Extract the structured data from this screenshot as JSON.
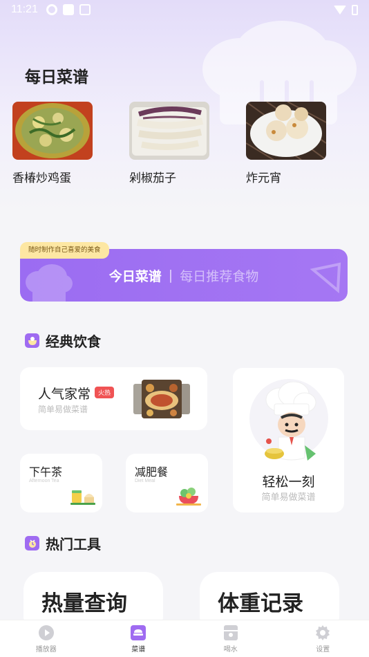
{
  "status_bar": {
    "time": "11:21"
  },
  "daily": {
    "title": "每日菜谱",
    "items": [
      {
        "name": "香椿炒鸡蛋"
      },
      {
        "name": "剁椒茄子"
      },
      {
        "name": "炸元宵"
      }
    ]
  },
  "banner": {
    "tag": "随时制作自己喜爱的美食",
    "main": "今日菜谱",
    "separator": "|",
    "sub": "每日推荐食物"
  },
  "classic": {
    "title": "经典饮食",
    "popular": {
      "title": "人气家常",
      "badge": "火热",
      "subtitle": "简单易做菜谱"
    },
    "easy": {
      "title": "轻松一刻",
      "subtitle": "简单易做菜谱"
    },
    "tea": {
      "title": "下午茶",
      "subtitle": "Afternoon Tea"
    },
    "diet": {
      "title": "减肥餐",
      "subtitle": "Diet Meal"
    }
  },
  "tools": {
    "title": "热门工具",
    "items": [
      {
        "label": "热量查询"
      },
      {
        "label": "体重记录"
      }
    ]
  },
  "nav": {
    "items": [
      {
        "label": "播放器",
        "icon": "player-icon"
      },
      {
        "label": "菜谱",
        "icon": "recipe-icon"
      },
      {
        "label": "喝水",
        "icon": "water-icon"
      },
      {
        "label": "设置",
        "icon": "gear-icon"
      }
    ],
    "active_index": 1
  },
  "colors": {
    "accent": "#9f6bf1",
    "hot": "#f05354",
    "tag": "#fde7a3"
  }
}
